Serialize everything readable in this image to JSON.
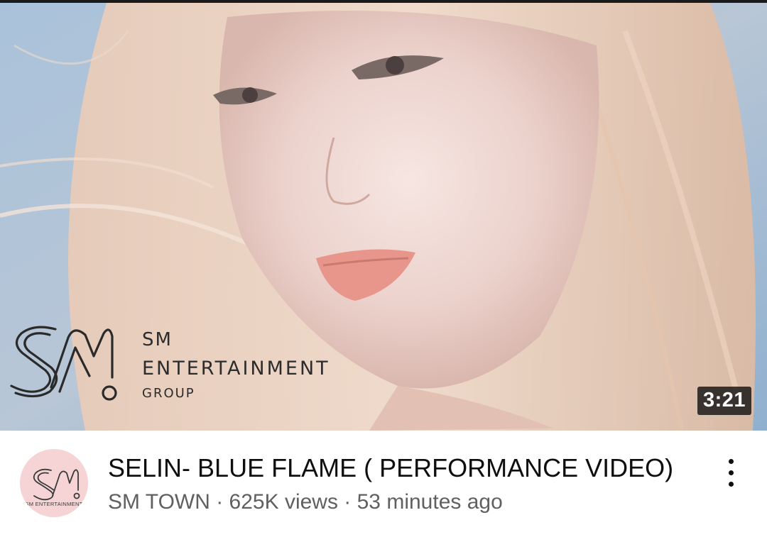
{
  "video": {
    "duration": "3:21",
    "title": "SELIN- BLUE FLAME ( PERFORMANCE VIDEO)",
    "meta_line": "SM TOWN · 625K views · 53 minutes ago"
  },
  "thumbnail_logo": {
    "line1": "SM",
    "line2": "ENTERTAINMENT",
    "line3": "GROUP"
  },
  "channel": {
    "avatar_caption": "SM ENTERTAINMENT",
    "avatar_bg": "#f6d4d6"
  },
  "icons": {
    "more": "vertical-ellipsis-icon",
    "logo": "sm-logo-icon"
  },
  "colors": {
    "title": "#0f0f0f",
    "meta": "#606060",
    "duration_bg": "#141414"
  }
}
